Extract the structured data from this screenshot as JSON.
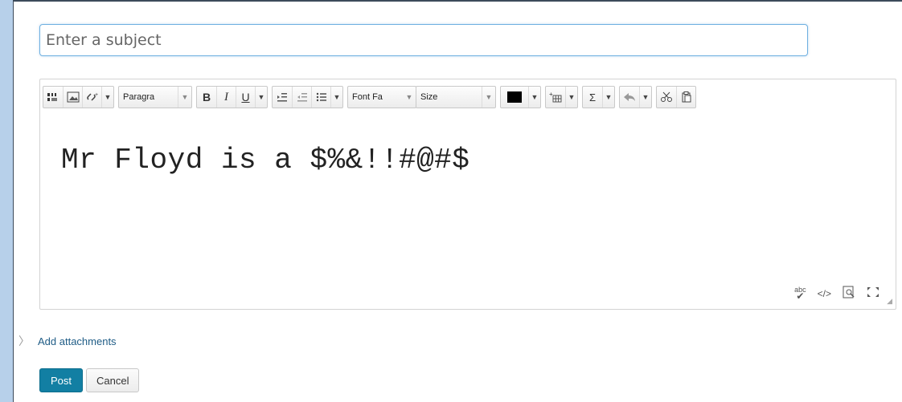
{
  "subject": {
    "placeholder": "Enter a subject",
    "value": ""
  },
  "toolbar": {
    "paragraph_label": "Paragra",
    "font_family_label": "Font Fa",
    "size_label": "Size",
    "color_swatch": "#000000",
    "icons": [
      "insert-stuff-icon",
      "insert-image-icon",
      "insert-link-icon",
      "bold-icon",
      "italic-icon",
      "underline-icon",
      "indent-icon",
      "outdent-icon",
      "bullet-list-icon",
      "text-color-icon",
      "table-icon",
      "equation-icon",
      "undo-icon",
      "cut-icon",
      "paste-icon"
    ],
    "bold": "B",
    "italic": "I",
    "underline": "U",
    "sigma": "Σ"
  },
  "editor": {
    "content": "Mr Floyd is a $%&!!#@#$",
    "status_icons": [
      "spellcheck-icon",
      "source-code-icon",
      "preview-icon",
      "fullscreen-icon"
    ]
  },
  "attachments": {
    "label": "Add attachments"
  },
  "actions": {
    "post": "Post",
    "cancel": "Cancel"
  },
  "colors": {
    "post_button": "#127fa3",
    "link": "#1f5c86",
    "focus_border": "#6fb0e0",
    "page_background": "#b7d0ea"
  }
}
